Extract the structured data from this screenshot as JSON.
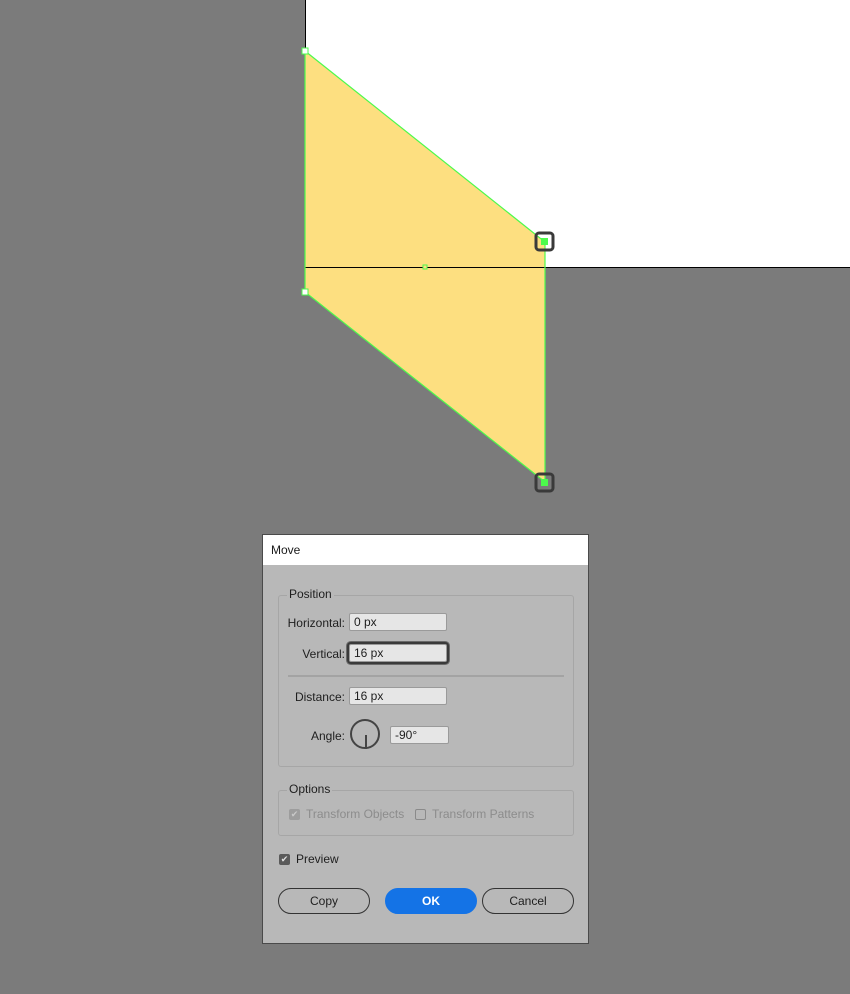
{
  "canvas": {
    "background_color": "#7b7b7b",
    "artboard_color": "#ffffff",
    "shape_fill_color": "#fddf80",
    "selection_color": "#4cfa4c"
  },
  "dialog": {
    "title": "Move",
    "position_group": {
      "legend": "Position",
      "horizontal_label": "Horizontal:",
      "horizontal_value": "0 px",
      "vertical_label": "Vertical:",
      "vertical_value": "16 px",
      "distance_label": "Distance:",
      "distance_value": "16 px",
      "angle_label": "Angle:",
      "angle_value": "-90°"
    },
    "options_group": {
      "legend": "Options",
      "transform_objects_label": "Transform Objects",
      "transform_objects_checked": true,
      "transform_patterns_label": "Transform Patterns",
      "transform_patterns_checked": false
    },
    "preview_label": "Preview",
    "preview_checked": true,
    "buttons": {
      "copy": "Copy",
      "ok": "OK",
      "cancel": "Cancel"
    },
    "accent_color": "#1473e6"
  }
}
